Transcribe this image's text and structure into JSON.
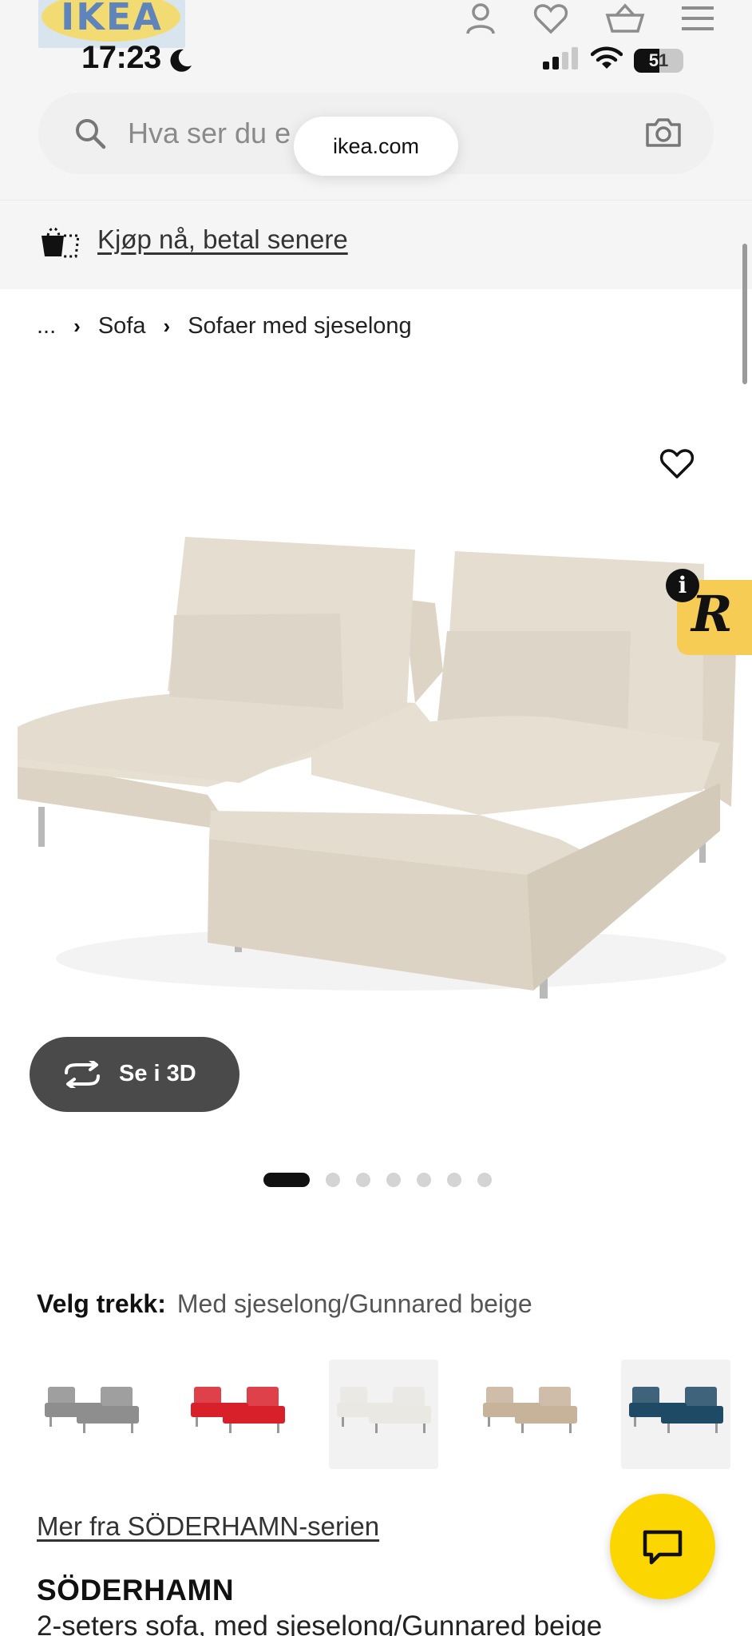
{
  "colors": {
    "brand_yellow": "#fcd600",
    "brand_blue": "#2d5fa8",
    "text": "#111111",
    "muted": "#555555",
    "button_dark": "#4a4a4a",
    "badge_yellow": "#f6cc55"
  },
  "header": {
    "logo_text": "IKEA",
    "icons": [
      "profile-icon",
      "heart-icon",
      "basket-icon",
      "menu-icon"
    ]
  },
  "status_bar": {
    "time": "17:23",
    "battery_level": "51",
    "icons": [
      "moon-icon",
      "signal-icon",
      "wifi-icon",
      "battery-icon"
    ]
  },
  "search": {
    "placeholder": "Hva ser du etter?",
    "visible_text": "Hva ser du e",
    "url_pill": "ikea.com"
  },
  "promo": {
    "label": "Kjøp nå, betal senere"
  },
  "breadcrumb": [
    "...",
    "Sofa",
    "Sofaer med sjeselong"
  ],
  "gallery": {
    "image_count": 7,
    "active_index": 0,
    "view_3d_label": "Se i 3D"
  },
  "overlay_badge": {
    "letter": "R",
    "info": "i"
  },
  "variant": {
    "label": "Velg trekk:",
    "value": "Med sjeselong/Gunnared beige",
    "swatch_colors": [
      "#8e8e8e",
      "#d8202a",
      "#e9e8e3",
      "#c7b29a",
      "#1f4a66"
    ]
  },
  "product": {
    "series_link": "Mer fra SÖDERHAMN-serien",
    "name": "SÖDERHAMN",
    "description": "2-seters sofa, med sjeselong/Gunnared beige"
  }
}
